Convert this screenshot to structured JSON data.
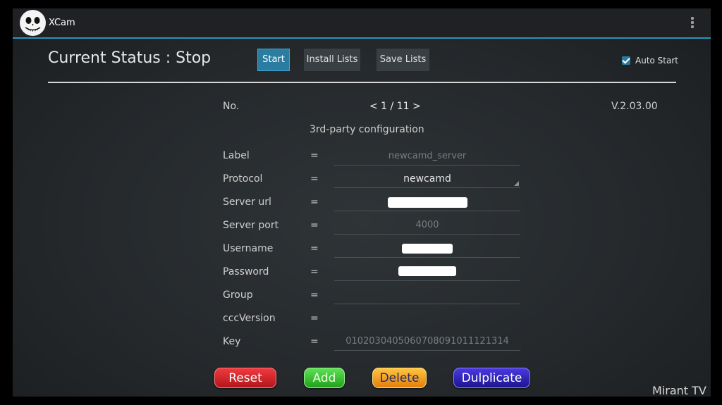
{
  "app": {
    "title": "XCam",
    "icon": "skull-face-icon",
    "menu_icon": "overflow-menu-icon"
  },
  "header": {
    "status": "Current Status : Stop",
    "buttons": {
      "start": "Start",
      "install": "Install Lists",
      "save": "Save Lists"
    },
    "auto_start": {
      "label": "Auto Start",
      "checked": true
    }
  },
  "config": {
    "no_label": "No.",
    "pager": "< 1 / 11 >",
    "version": "V.2.03.00",
    "section_title": "3rd-party configuration",
    "eq": "=",
    "fields": [
      {
        "label": "Label",
        "value": "newcamd_server"
      },
      {
        "label": "Protocol",
        "value": "newcamd"
      },
      {
        "label": "Server url",
        "value": ""
      },
      {
        "label": "Server port",
        "value": "4000"
      },
      {
        "label": "Username",
        "value": ""
      },
      {
        "label": "Password",
        "value": ""
      },
      {
        "label": "Group",
        "value": ""
      },
      {
        "label": "cccVersion",
        "value": ""
      },
      {
        "label": "Key",
        "value": "0102030405060708091011121314"
      }
    ]
  },
  "actions": {
    "reset": "Reset",
    "add": "Add",
    "delete": "Delete",
    "duplicate": "Dulplicate"
  },
  "watermark": "Mirant TV",
  "colors": {
    "accent": "#2a93b8",
    "reset": "#d8262c",
    "add": "#38c030",
    "delete": "#f2a11e",
    "duplicate": "#2a1fb0"
  }
}
